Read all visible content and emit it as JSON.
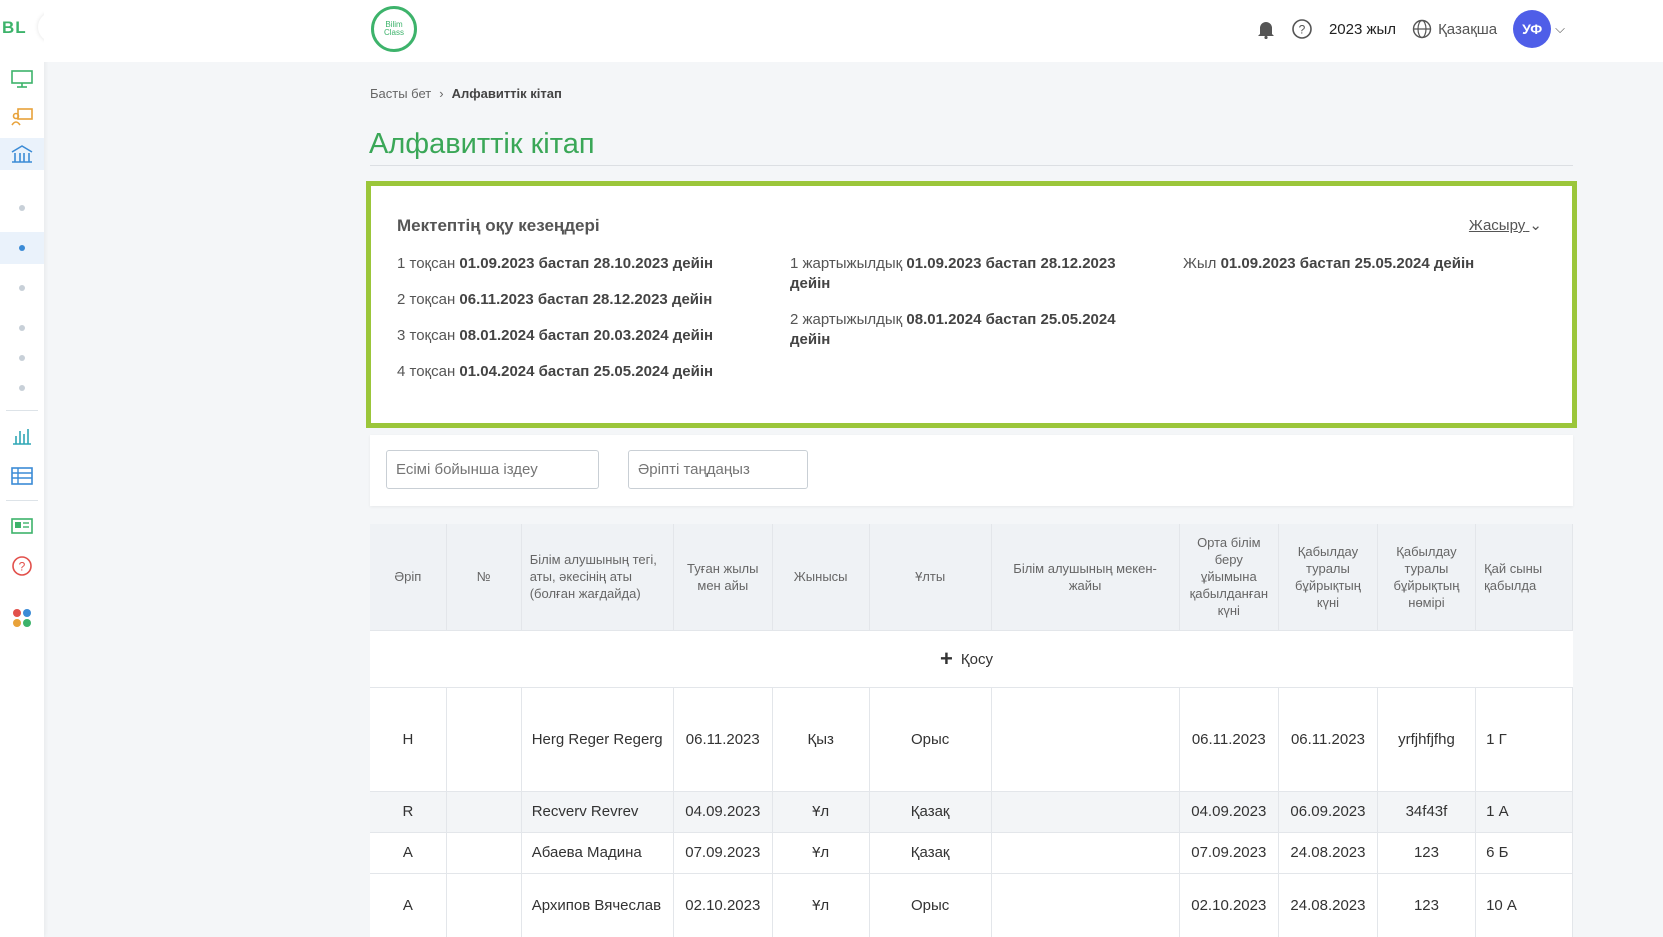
{
  "sidebar": {
    "logo": "BL",
    "items": [
      {
        "icon": "monitor-icon"
      },
      {
        "icon": "teacher-board-icon"
      },
      {
        "icon": "school-building-icon",
        "active": true
      },
      {
        "icon": "dot"
      },
      {
        "icon": "dot",
        "active": true
      },
      {
        "icon": "dot"
      },
      {
        "icon": "dot"
      },
      {
        "icon": "dot"
      },
      {
        "icon": "dot"
      },
      {
        "icon": "bar-chart-icon"
      },
      {
        "icon": "table-icon"
      },
      {
        "icon": "news-icon"
      },
      {
        "icon": "help-icon"
      },
      {
        "icon": "apps-icon"
      }
    ]
  },
  "header": {
    "brand_line1": "Bilim",
    "brand_line2": "Class",
    "year": "2023 жыл",
    "language": "Қазақша",
    "avatar_initials": "УФ"
  },
  "breadcrumb": {
    "home": "Басты бет",
    "current": "Алфавиттік кітап"
  },
  "page_title": "Алфавиттік кітап",
  "periods": {
    "title": "Мектептің оқу кезеңдері",
    "hide_label": "Жасыру",
    "quarters": [
      {
        "label": "1 тоқсан",
        "range": "01.09.2023 бастап 28.10.2023 дейін"
      },
      {
        "label": "2 тоқсан",
        "range": "06.11.2023 бастап 28.12.2023 дейін"
      },
      {
        "label": "3 тоқсан",
        "range": "08.01.2024 бастап 20.03.2024 дейін"
      },
      {
        "label": "4 тоқсан",
        "range": "01.04.2024 бастап 25.05.2024 дейін"
      }
    ],
    "halves": [
      {
        "label": "1 жартыжылдық",
        "range": "01.09.2023 бастап 28.12.2023 дейін"
      },
      {
        "label": "2 жартыжылдық",
        "range": "08.01.2024 бастап 25.05.2024 дейін"
      }
    ],
    "year": {
      "label": "Жыл",
      "range": "01.09.2023 бастап 25.05.2024 дейін"
    }
  },
  "filters": {
    "search_placeholder": "Есімі бойынша іздеу",
    "letter_placeholder": "Әріпті таңдаңыз"
  },
  "table": {
    "headers": [
      "Әріп",
      "№",
      "Білім алушының тегі, аты, әкесінің аты (болған жағдайда)",
      "Туған жылы мен айы",
      "Жынысы",
      "Ұлты",
      "Білім алушының мекен-жайы",
      "Орта білім беру ұйымына қабылданған күні",
      "Қабылдау туралы бұйрықтың күні",
      "Қабылдау туралы бұйрықтың нөмірі",
      "Қай сыны қабылда"
    ],
    "add_label": "Қосу",
    "rows": [
      {
        "letter": "H",
        "num": "",
        "name": "Herg Reger Regerg",
        "birth": "06.11.2023",
        "gender": "Қыз",
        "nationality": "Орыс",
        "address": "",
        "admitted": "06.11.2023",
        "order_date": "06.11.2023",
        "order_no": "yrfjhfjfhg",
        "class": "1 Г"
      },
      {
        "letter": "R",
        "num": "",
        "name": "Recverv Revrev",
        "birth": "04.09.2023",
        "gender": "Ұл",
        "nationality": "Қазақ",
        "address": "",
        "admitted": "04.09.2023",
        "order_date": "06.09.2023",
        "order_no": "34f43f",
        "class": "1 А"
      },
      {
        "letter": "А",
        "num": "",
        "name": "Абаева Мадина",
        "birth": "07.09.2023",
        "gender": "Ұл",
        "nationality": "Қазақ",
        "address": "",
        "admitted": "07.09.2023",
        "order_date": "24.08.2023",
        "order_no": "123",
        "class": "6 Б"
      },
      {
        "letter": "А",
        "num": "",
        "name": "Архипов Вячеслав",
        "birth": "02.10.2023",
        "gender": "Ұл",
        "nationality": "Орыс",
        "address": "",
        "admitted": "02.10.2023",
        "order_date": "24.08.2023",
        "order_no": "123",
        "class": "10 А"
      }
    ]
  }
}
